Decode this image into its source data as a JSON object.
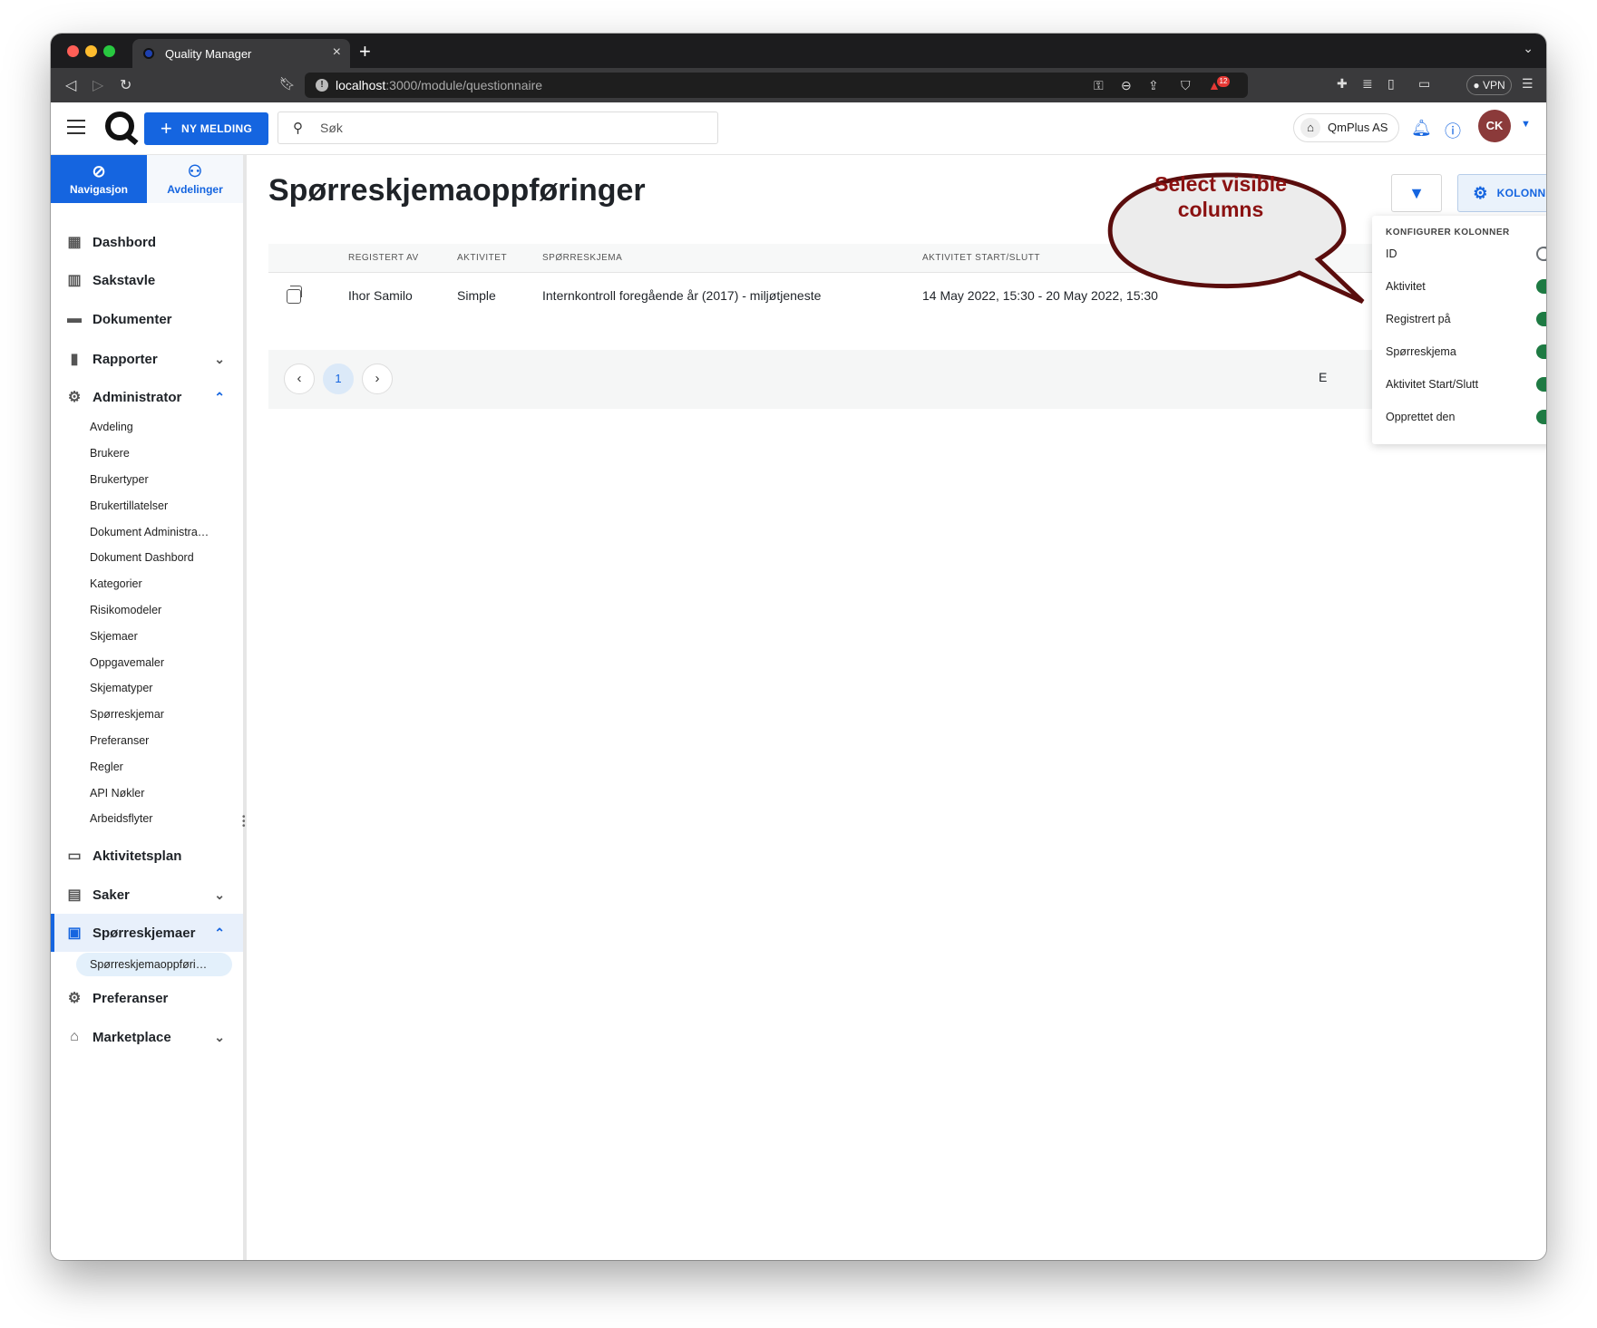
{
  "browser": {
    "tab_title": "Quality Manager",
    "url_host": "localhost",
    "url_path": ":3000/module/questionnaire",
    "badge_count": "12",
    "vpn_label": "VPN"
  },
  "header": {
    "new_message_label": "NY MELDING",
    "search_placeholder": "Søk",
    "org_name": "QmPlus AS",
    "avatar_initials": "CK"
  },
  "sidebar": {
    "tabs": [
      {
        "label": "Navigasjon",
        "icon": "compass-icon"
      },
      {
        "label": "Avdelinger",
        "icon": "org-chart-icon"
      }
    ],
    "items": {
      "dashbord": "Dashbord",
      "sakstavle": "Sakstavle",
      "dokumenter": "Dokumenter",
      "rapporter": "Rapporter",
      "administrator": "Administrator",
      "aktivitetsplan": "Aktivitetsplan",
      "saker": "Saker",
      "sporreskjemaer": "Spørreskjemaer",
      "preferanser": "Preferanser",
      "marketplace": "Marketplace"
    },
    "admin_subitems": [
      "Avdeling",
      "Brukere",
      "Brukertyper",
      "Brukertillatelser",
      "Dokument Administra…",
      "Dokument Dashbord",
      "Kategorier",
      "Risikomodeler",
      "Skjemaer",
      "Oppgavemaler",
      "Skjematyper",
      "Spørreskjemar",
      "Preferanser",
      "Regler",
      "API Nøkler",
      "Arbeidsflyter"
    ],
    "questionnaire_subitem": "Spørreskjemaoppføri…"
  },
  "main": {
    "title": "Spørreskjemaoppføringer",
    "columns_button": "KOLONNER",
    "table": {
      "headers": [
        "REGISTERT AV",
        "AKTIVITET",
        "SPØRRESKJEMA",
        "AKTIVITET START/SLUTT"
      ],
      "rows": [
        [
          "Ihor Samilo",
          "Simple",
          "Internkontroll foregående år (2017) - miljøtjeneste",
          "14 May 2022, 15:30 - 20 May 2022, 15:30"
        ]
      ]
    },
    "pagination": {
      "current_page": "1",
      "prev": "‹",
      "next": "›",
      "truncated_text": "E"
    }
  },
  "columns_dropdown": {
    "heading": "KONFIGURER KOLONNER",
    "options": [
      {
        "label": "ID",
        "enabled": false
      },
      {
        "label": "Aktivitet",
        "enabled": true
      },
      {
        "label": "Registrert på",
        "enabled": true
      },
      {
        "label": "Spørreskjema",
        "enabled": true
      },
      {
        "label": "Aktivitet Start/Slutt",
        "enabled": true
      },
      {
        "label": "Opprettet den",
        "enabled": true
      }
    ]
  },
  "callout": {
    "line1": "Select visible",
    "line2": "columns"
  },
  "colors": {
    "accent": "#1565e0",
    "toggle_on": "#1e7a43",
    "toggle_off": "#6b7075",
    "callout_text": "#8b1212",
    "callout_fill": "#ececec",
    "avatar": "#8b3a3a"
  }
}
